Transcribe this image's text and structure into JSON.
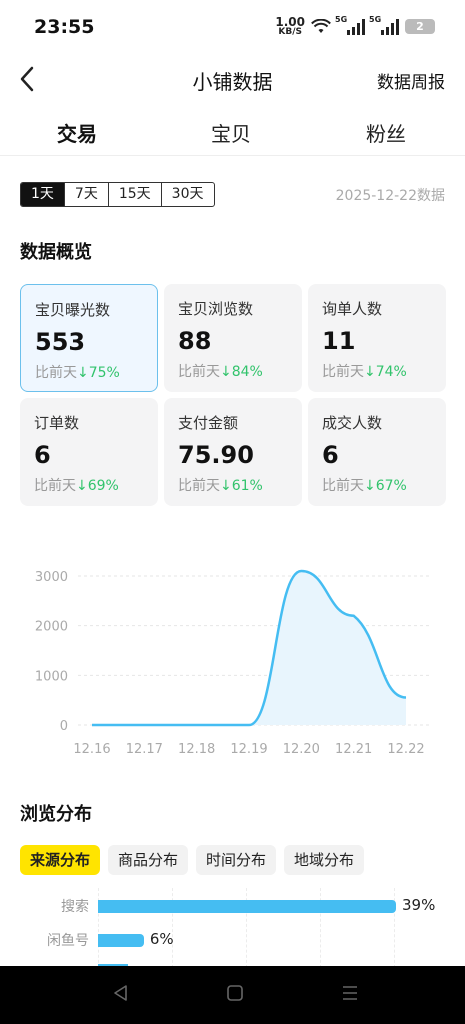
{
  "status": {
    "time": "23:55",
    "speed_value": "1.00",
    "speed_unit": "KB/S",
    "net1": "5G",
    "net2": "5G",
    "battery": "2"
  },
  "nav": {
    "title": "小铺数据",
    "weekly": "数据周报"
  },
  "tabs": [
    {
      "label": "交易"
    },
    {
      "label": "宝贝"
    },
    {
      "label": "粉丝"
    }
  ],
  "range": {
    "options": [
      "1天",
      "7天",
      "15天",
      "30天"
    ],
    "selected": "1天",
    "date": "2025-12-22数据"
  },
  "overview": {
    "title": "数据概览",
    "compare_prefix": "比前天",
    "cards": [
      {
        "label": "宝贝曝光数",
        "value": "553",
        "change": "↓75%"
      },
      {
        "label": "宝贝浏览数",
        "value": "88",
        "change": "↓84%"
      },
      {
        "label": "询单人数",
        "value": "11",
        "change": "↓74%"
      },
      {
        "label": "订单数",
        "value": "6",
        "change": "↓69%"
      },
      {
        "label": "支付金额",
        "value": "75.90",
        "change": "↓61%"
      },
      {
        "label": "成交人数",
        "value": "6",
        "change": "↓67%"
      }
    ]
  },
  "chart_data": {
    "type": "area",
    "x": [
      "12.16",
      "12.17",
      "12.18",
      "12.19",
      "12.20",
      "12.21",
      "12.22"
    ],
    "values": [
      0,
      0,
      0,
      0,
      3100,
      2200,
      553
    ],
    "yticks": [
      "0",
      "1000",
      "2000",
      "3000"
    ],
    "ylim": [
      0,
      3000
    ],
    "grid": true,
    "color": "#45bdf2"
  },
  "browse": {
    "title": "浏览分布",
    "chips": [
      "来源分布",
      "商品分布",
      "时间分布",
      "地域分布"
    ],
    "selected": "来源分布",
    "rows": [
      {
        "name": "搜索",
        "pct": "39%",
        "value": 39
      },
      {
        "name": "闲鱼号",
        "pct": "6%",
        "value": 6
      }
    ]
  }
}
